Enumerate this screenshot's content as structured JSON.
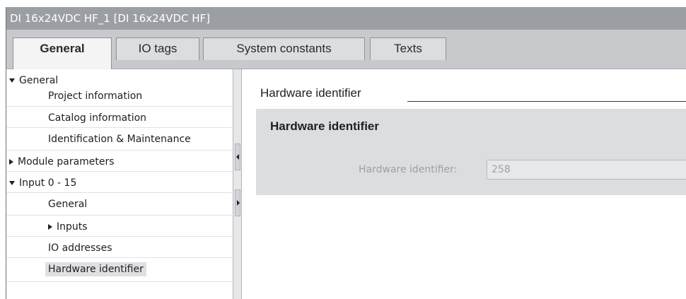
{
  "window": {
    "title": "DI 16x24VDC HF_1 [DI 16x24VDC HF]"
  },
  "tabs": [
    {
      "label": "General",
      "active": true
    },
    {
      "label": "IO tags",
      "active": false
    },
    {
      "label": "System constants",
      "active": false
    },
    {
      "label": "Texts",
      "active": false
    }
  ],
  "nav": {
    "items": [
      {
        "label": "General",
        "expander": "expanded"
      },
      {
        "label": "Project information"
      },
      {
        "label": "Catalog information"
      },
      {
        "label": "Identification & Maintenance"
      },
      {
        "label": "Module parameters",
        "expander": "collapsed"
      },
      {
        "label": "Input 0 - 15",
        "expander": "expanded"
      },
      {
        "label": "General"
      },
      {
        "label": "Inputs",
        "expander": "collapsed"
      },
      {
        "label": "IO addresses"
      },
      {
        "label": "Hardware identifier",
        "selected": true
      }
    ]
  },
  "main": {
    "section_title": "Hardware identifier",
    "panel_title": "Hardware identifier",
    "field_label": "Hardware identifier:",
    "field_value": "258"
  },
  "colors": {
    "titlebar_bg": "#9b9ea3",
    "tabbar_bg": "#c7c9cc",
    "panel_bg": "#dcdde0",
    "disabled_text": "#9ea0a3"
  }
}
